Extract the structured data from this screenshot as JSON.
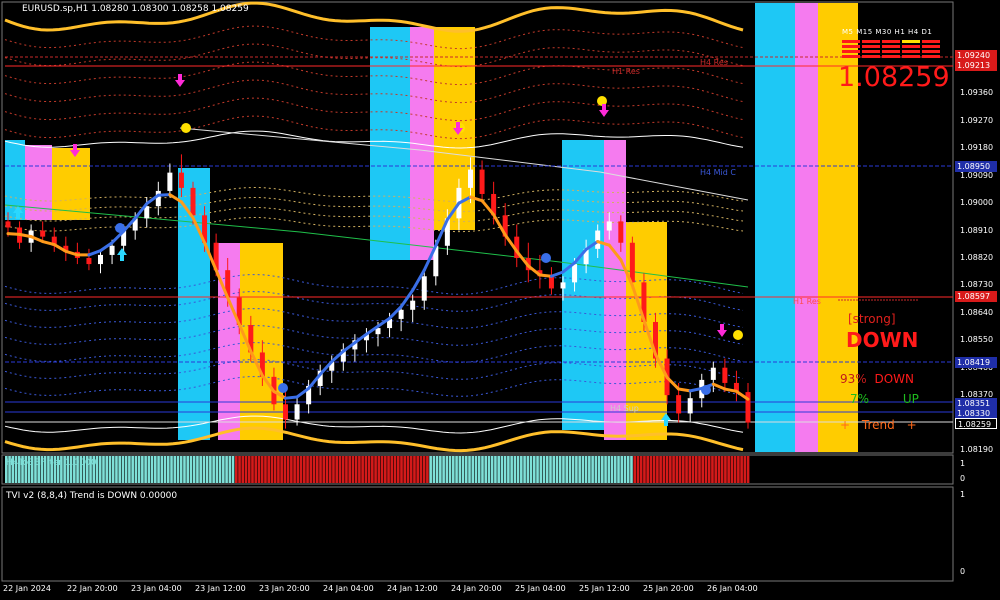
{
  "header": {
    "chart_title": "EURUSD.sp,H1  1.08280 1.08300 1.08258 1.08259",
    "indicator1_title": "H4ToBEFilter 1.0000",
    "indicator2_title": "TVI v2 (8,8,4) Trend is DOWN 0.00000"
  },
  "panel": {
    "timeframes": "M5 M15 M30 H1 H4 D1",
    "current_price": "1.08259",
    "strength": "[strong]",
    "direction": "DOWN",
    "down_pct_value": "93%",
    "down_pct_label": "DOWN",
    "up_pct_value": "7%",
    "up_pct_label": "UP",
    "trend_left": "+",
    "trend_label": "Trend",
    "trend_right": "+"
  },
  "levels": {
    "h1_res": "H1 Res",
    "h4_sup": "H4 Sup",
    "h1_res_top": "H1 Res",
    "h4_res_top": "H4 Res",
    "h4_mid": "H4 Mid C"
  },
  "price_boxes": [
    "1.09240",
    "1.09213",
    "1.08950",
    "1.08597",
    "1.08419",
    "1.08351",
    "1.08330",
    "1.08259"
  ],
  "colors": {
    "bull_candle": "#ffffff",
    "bear_candle": "#ff1a1a",
    "cyan_block": "#1ec8f5",
    "pink_block": "#f57bef",
    "gold_block": "#ffcc00",
    "orange_line": "#ff9a1a",
    "blue_line": "#3a6fe8",
    "gold_envelope": "#ffbf2a",
    "hist_up": "#7fe0d8",
    "hist_down": "#d41a1a",
    "accent_red": "#ff1a1a"
  },
  "chart_data": {
    "type": "candlestick",
    "symbol": "EURUSD.sp",
    "timeframe": "H1",
    "ylim": [
      1.0819,
      1.0965
    ],
    "y_ticks": [
      "1.09360",
      "1.09270",
      "1.09180",
      "1.09090",
      "1.09000",
      "1.08910",
      "1.08820",
      "1.08730",
      "1.08640",
      "1.08550",
      "1.08460",
      "1.08370",
      "1.08280",
      "1.08190"
    ],
    "x_ticks": [
      "22 Jan 2024",
      "22 Jan 20:00",
      "23 Jan 04:00",
      "23 Jan 12:00",
      "23 Jan 20:00",
      "24 Jan 04:00",
      "24 Jan 12:00",
      "24 Jan 20:00",
      "25 Jan 04:00",
      "25 Jan 12:00",
      "25 Jan 20:00",
      "26 Jan 04:00"
    ],
    "ohlc": [
      [
        1.0894,
        1.0897,
        1.0889,
        1.0892
      ],
      [
        1.0892,
        1.0894,
        1.0885,
        1.0887
      ],
      [
        1.0887,
        1.0893,
        1.0884,
        1.0891
      ],
      [
        1.0891,
        1.0894,
        1.0887,
        1.0889
      ],
      [
        1.0889,
        1.0892,
        1.0884,
        1.0886
      ],
      [
        1.0886,
        1.0889,
        1.0881,
        1.0884
      ],
      [
        1.0884,
        1.0887,
        1.088,
        1.0882
      ],
      [
        1.0882,
        1.0885,
        1.0878,
        1.088
      ],
      [
        1.088,
        1.0884,
        1.0877,
        1.0883
      ],
      [
        1.0883,
        1.0888,
        1.088,
        1.0886
      ],
      [
        1.0886,
        1.0893,
        1.0884,
        1.0891
      ],
      [
        1.0891,
        1.0897,
        1.0888,
        1.0895
      ],
      [
        1.0895,
        1.0902,
        1.0892,
        1.0899
      ],
      [
        1.0899,
        1.0907,
        1.0896,
        1.0904
      ],
      [
        1.0904,
        1.0913,
        1.0902,
        1.091
      ],
      [
        1.091,
        1.0916,
        1.0902,
        1.0905
      ],
      [
        1.0905,
        1.0907,
        1.0893,
        1.0896
      ],
      [
        1.0896,
        1.0899,
        1.0884,
        1.0887
      ],
      [
        1.0887,
        1.089,
        1.0876,
        1.0878
      ],
      [
        1.0878,
        1.0882,
        1.0866,
        1.0869
      ],
      [
        1.0869,
        1.0872,
        1.0857,
        1.086
      ],
      [
        1.086,
        1.0863,
        1.0848,
        1.0851
      ],
      [
        1.0851,
        1.0855,
        1.084,
        1.0843
      ],
      [
        1.0843,
        1.0846,
        1.0832,
        1.0834
      ],
      [
        1.0834,
        1.0838,
        1.0826,
        1.0829
      ],
      [
        1.0829,
        1.0836,
        1.0827,
        1.0834
      ],
      [
        1.0834,
        1.0842,
        1.0831,
        1.084
      ],
      [
        1.084,
        1.0847,
        1.0837,
        1.0845
      ],
      [
        1.0845,
        1.085,
        1.0841,
        1.0848
      ],
      [
        1.0848,
        1.0854,
        1.0845,
        1.0852
      ],
      [
        1.0852,
        1.0857,
        1.0848,
        1.0855
      ],
      [
        1.0855,
        1.0859,
        1.0851,
        1.0857
      ],
      [
        1.0857,
        1.0861,
        1.0853,
        1.0859
      ],
      [
        1.0859,
        1.0864,
        1.0856,
        1.0862
      ],
      [
        1.0862,
        1.0867,
        1.0858,
        1.0865
      ],
      [
        1.0865,
        1.087,
        1.0861,
        1.0868
      ],
      [
        1.0868,
        1.0878,
        1.0865,
        1.0876
      ],
      [
        1.0876,
        1.0888,
        1.0873,
        1.0886
      ],
      [
        1.0886,
        1.0898,
        1.0883,
        1.0895
      ],
      [
        1.0895,
        1.0908,
        1.0891,
        1.0905
      ],
      [
        1.0905,
        1.0915,
        1.09,
        1.0911
      ],
      [
        1.0911,
        1.0914,
        1.09,
        1.0903
      ],
      [
        1.0903,
        1.0907,
        1.0893,
        1.0896
      ],
      [
        1.0896,
        1.09,
        1.0886,
        1.0889
      ],
      [
        1.0889,
        1.0893,
        1.0879,
        1.0882
      ],
      [
        1.0882,
        1.0887,
        1.0874,
        1.0878
      ],
      [
        1.0878,
        1.0883,
        1.0872,
        1.0876
      ],
      [
        1.0876,
        1.0879,
        1.087,
        1.0872
      ],
      [
        1.0872,
        1.0876,
        1.0868,
        1.0874
      ],
      [
        1.0874,
        1.0882,
        1.0871,
        1.088
      ],
      [
        1.088,
        1.0888,
        1.0877,
        1.0885
      ],
      [
        1.0885,
        1.0893,
        1.0882,
        1.0891
      ],
      [
        1.0891,
        1.0897,
        1.0888,
        1.0894
      ],
      [
        1.0894,
        1.0896,
        1.0884,
        1.0887
      ],
      [
        1.0887,
        1.0889,
        1.0872,
        1.0874
      ],
      [
        1.0874,
        1.0877,
        1.0858,
        1.0861
      ],
      [
        1.0861,
        1.0864,
        1.0846,
        1.0849
      ],
      [
        1.0849,
        1.0852,
        1.0834,
        1.0837
      ],
      [
        1.0837,
        1.0841,
        1.0828,
        1.0831
      ],
      [
        1.0831,
        1.0838,
        1.0828,
        1.0836
      ],
      [
        1.0836,
        1.0844,
        1.0833,
        1.0842
      ],
      [
        1.0842,
        1.0848,
        1.0838,
        1.0846
      ],
      [
        1.0846,
        1.0849,
        1.0838,
        1.0841
      ],
      [
        1.0841,
        1.0845,
        1.0835,
        1.0838
      ],
      [
        1.0838,
        1.0841,
        1.0826,
        1.0828
      ]
    ],
    "histogram_h4_filter": {
      "ylim": [
        0,
        1
      ],
      "up_bars": 71,
      "down_bars_1": 60,
      "up_bars_2": 63,
      "down_bars_2": 36
    },
    "tvi": {
      "ylim": [
        0,
        1
      ],
      "value": 0.0
    }
  }
}
